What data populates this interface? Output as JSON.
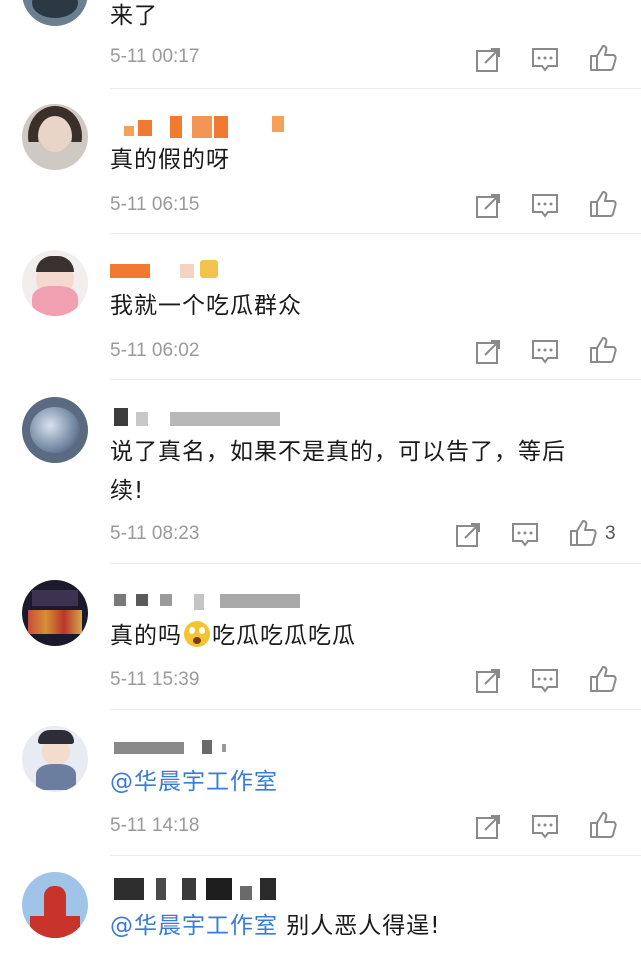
{
  "comments": [
    {
      "text": "来了",
      "time": "5-11 00:17"
    },
    {
      "text": "真的假的呀",
      "time": "5-11 06:15"
    },
    {
      "text": "我就一个吃瓜群众",
      "time": "5-11 06:02"
    },
    {
      "text_line1": "说了真名，如果不是真的，可以告了，等后",
      "text_line2": "续!",
      "time": "5-11 08:23",
      "likes": "3"
    },
    {
      "text_before": "真的吗",
      "text_after": "吃瓜吃瓜吃瓜",
      "time": "5-11 15:39"
    },
    {
      "mention": "@华晨宇工作室",
      "time": "5-11 14:18"
    },
    {
      "mention": "@华晨宇工作室",
      "text": " 别人恶人得逞!"
    }
  ],
  "icons": {
    "share": "share-icon",
    "reply": "comment-icon",
    "like": "thumb-up-icon"
  },
  "colors": {
    "mention": "#3a7bd5",
    "time": "#9a9a9a",
    "icon": "#8a8a8a"
  }
}
